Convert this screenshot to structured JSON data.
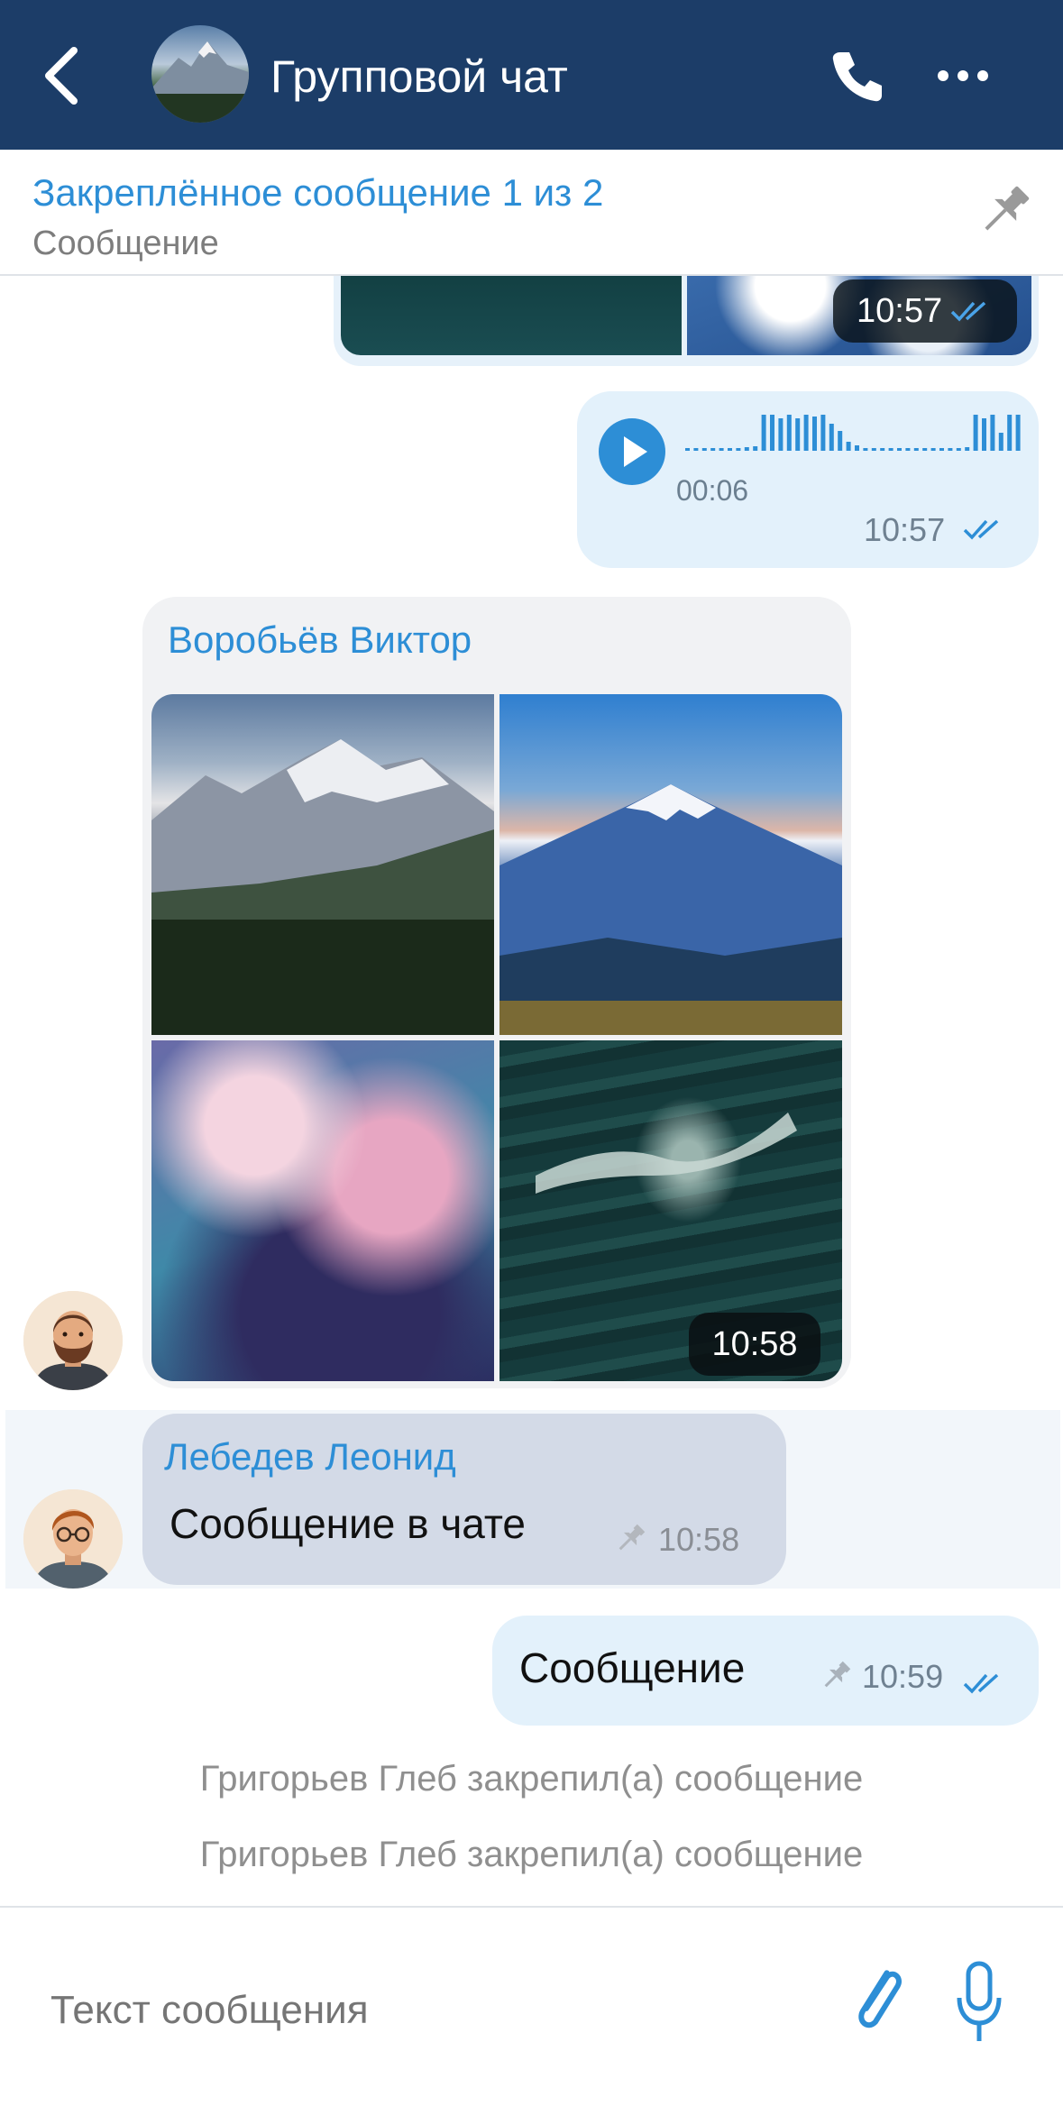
{
  "header": {
    "title": "Групповой чат",
    "back_icon": "chevron-left-icon",
    "call_icon": "phone-icon",
    "more_icon": "more-dots-icon",
    "bg_color": "#1c3d68"
  },
  "pinned": {
    "title": "Закреплённое сообщение 1 из 2",
    "subtitle": "Сообщение",
    "icon": "pin-icon"
  },
  "messages": {
    "prev_media": {
      "time": "10:57",
      "status": "read"
    },
    "voice": {
      "duration": "00:06",
      "time": "10:57",
      "status": "read"
    },
    "media_group": {
      "sender": "Воробьёв Виктор",
      "time": "10:58",
      "photo_count": 4
    },
    "text_in": {
      "sender": "Лебедев Леонид",
      "text": "Сообщение в чате",
      "time": "10:58",
      "pinned": true
    },
    "text_out": {
      "text": "Сообщение",
      "time": "10:59",
      "pinned": true,
      "status": "read"
    }
  },
  "service": [
    "Григорьев Глеб закрепил(а) сообщение",
    "Григорьев Глеб закрепил(а) сообщение"
  ],
  "input": {
    "placeholder": "Текст сообщения",
    "attach_icon": "paperclip-icon",
    "mic_icon": "microphone-icon"
  },
  "colors": {
    "accent": "#2d8ed6",
    "outgoing_bubble": "#e3f1fb",
    "incoming_bubble": "#f1f2f4",
    "selected_bubble": "#d3dae7"
  }
}
